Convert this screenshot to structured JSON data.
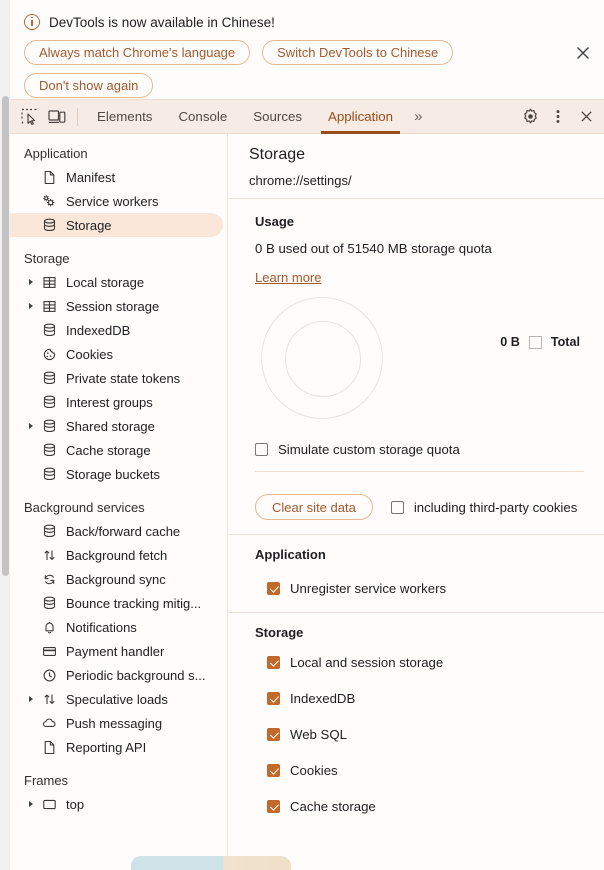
{
  "banner": {
    "icon": "info-circle-icon",
    "message": "DevTools is now available in Chinese!",
    "buttons": [
      {
        "label": "Always match Chrome's language",
        "name": "always-match-language-button"
      },
      {
        "label": "Switch DevTools to Chinese",
        "name": "switch-devtools-chinese-button"
      },
      {
        "label": "Don't show again",
        "name": "dont-show-again-button"
      }
    ],
    "close_icon": "close-icon"
  },
  "toolbar": {
    "inspect_icon": "inspect-element-icon",
    "device_icon": "device-toolbar-icon",
    "tabs": [
      {
        "label": "Elements",
        "active": false
      },
      {
        "label": "Console",
        "active": false
      },
      {
        "label": "Sources",
        "active": false
      },
      {
        "label": "Application",
        "active": true
      }
    ],
    "more_tabs": "»",
    "settings_icon": "gear-icon",
    "menu_icon": "more-vertical-icon",
    "close_icon": "close-icon"
  },
  "sidebar": {
    "groups": [
      {
        "title": "Application",
        "items": [
          {
            "label": "Manifest",
            "icon": "document-icon",
            "twisty": false,
            "selected": false
          },
          {
            "label": "Service workers",
            "icon": "gears-icon",
            "twisty": false,
            "selected": false
          },
          {
            "label": "Storage",
            "icon": "database-icon",
            "twisty": false,
            "selected": true
          }
        ]
      },
      {
        "title": "Storage",
        "items": [
          {
            "label": "Local storage",
            "icon": "table-icon",
            "twisty": true,
            "selected": false
          },
          {
            "label": "Session storage",
            "icon": "table-icon",
            "twisty": true,
            "selected": false
          },
          {
            "label": "IndexedDB",
            "icon": "database-icon",
            "twisty": false,
            "selected": false
          },
          {
            "label": "Cookies",
            "icon": "cookie-icon",
            "twisty": false,
            "selected": false
          },
          {
            "label": "Private state tokens",
            "icon": "database-icon",
            "twisty": false,
            "selected": false
          },
          {
            "label": "Interest groups",
            "icon": "database-icon",
            "twisty": false,
            "selected": false
          },
          {
            "label": "Shared storage",
            "icon": "database-icon",
            "twisty": true,
            "selected": false
          },
          {
            "label": "Cache storage",
            "icon": "database-icon",
            "twisty": false,
            "selected": false
          },
          {
            "label": "Storage buckets",
            "icon": "database-icon",
            "twisty": false,
            "selected": false
          }
        ]
      },
      {
        "title": "Background services",
        "items": [
          {
            "label": "Back/forward cache",
            "icon": "database-icon",
            "twisty": false,
            "selected": false
          },
          {
            "label": "Background fetch",
            "icon": "arrows-updown-icon",
            "twisty": false,
            "selected": false
          },
          {
            "label": "Background sync",
            "icon": "sync-icon",
            "twisty": false,
            "selected": false
          },
          {
            "label": "Bounce tracking mitig...",
            "icon": "database-icon",
            "twisty": false,
            "selected": false
          },
          {
            "label": "Notifications",
            "icon": "bell-icon",
            "twisty": false,
            "selected": false
          },
          {
            "label": "Payment handler",
            "icon": "credit-card-icon",
            "twisty": false,
            "selected": false
          },
          {
            "label": "Periodic background s...",
            "icon": "clock-icon",
            "twisty": false,
            "selected": false
          },
          {
            "label": "Speculative loads",
            "icon": "arrows-updown-icon",
            "twisty": true,
            "selected": false
          },
          {
            "label": "Push messaging",
            "icon": "cloud-icon",
            "twisty": false,
            "selected": false
          },
          {
            "label": "Reporting API",
            "icon": "document-icon",
            "twisty": false,
            "selected": false
          }
        ]
      },
      {
        "title": "Frames",
        "items": [
          {
            "label": "top",
            "icon": "frame-icon",
            "twisty": true,
            "selected": false
          }
        ]
      }
    ]
  },
  "main": {
    "title": "Storage",
    "origin": "chrome://settings/",
    "usage": {
      "heading": "Usage",
      "line": "0 B used out of 51540 MB storage quota",
      "learn_more": "Learn more",
      "legend_value": "0 B",
      "legend_label": "Total",
      "simulate_quota_label": "Simulate custom storage quota",
      "simulate_quota_checked": false
    },
    "clear": {
      "button_label": "Clear site data",
      "third_party_label": "including third-party cookies",
      "third_party_checked": false
    },
    "application_block": {
      "heading": "Application",
      "items": [
        {
          "label": "Unregister service workers",
          "checked": true
        }
      ]
    },
    "storage_block": {
      "heading": "Storage",
      "items": [
        {
          "label": "Local and session storage",
          "checked": true
        },
        {
          "label": "IndexedDB",
          "checked": true
        },
        {
          "label": "Web SQL",
          "checked": true
        },
        {
          "label": "Cookies",
          "checked": true
        },
        {
          "label": "Cache storage",
          "checked": true
        }
      ]
    }
  },
  "chart_data": {
    "type": "pie",
    "title": "Usage",
    "categories": [
      "Total"
    ],
    "values": [
      0
    ],
    "unit": "B",
    "legend_position": "right",
    "total_quota_mb": 51540,
    "used_bytes": 0,
    "annotations": [
      "0 B used out of 51540 MB storage quota"
    ]
  },
  "colors": {
    "accent": "#a35a2c",
    "accent_border": "#e8b894",
    "toolbar_bg": "#f7ebe5",
    "selected_bg": "#fbe6da",
    "checkbox_checked": "#bf6a2b",
    "divider": "#f3ddd0",
    "page_bg": "#fffcfb"
  }
}
